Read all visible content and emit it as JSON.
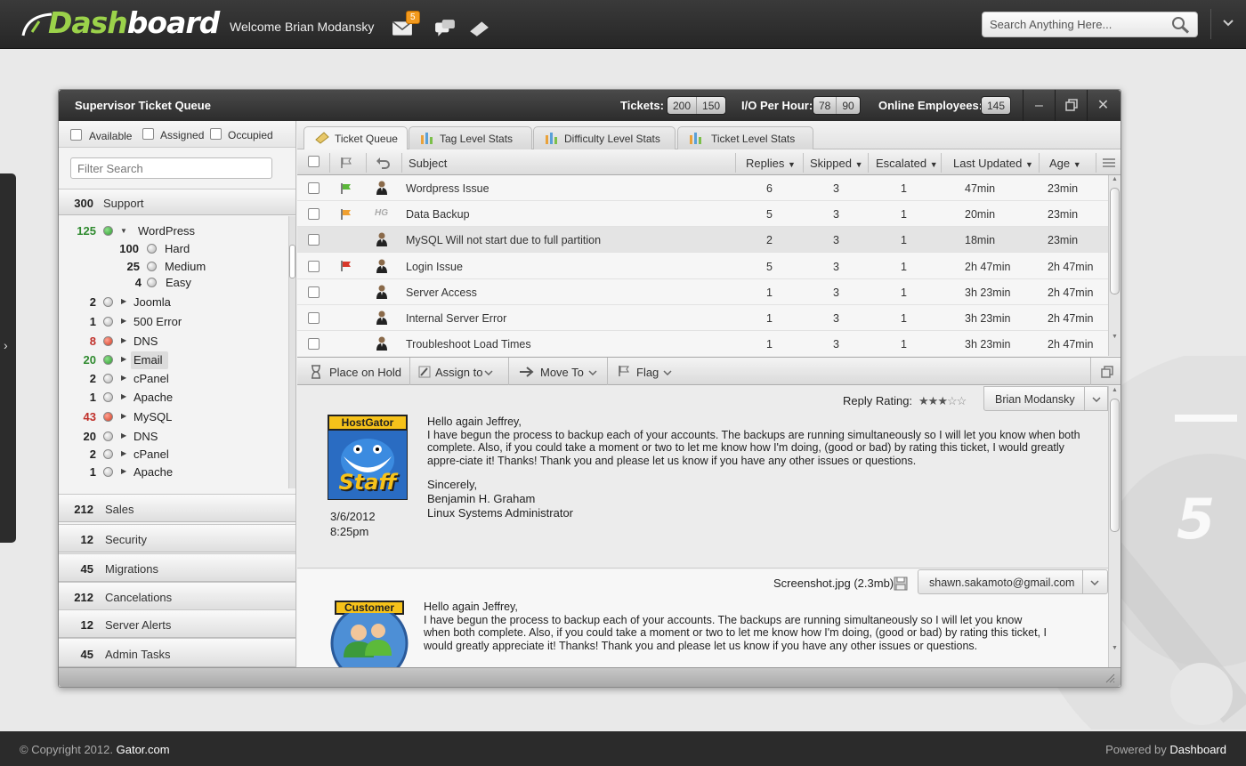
{
  "header": {
    "logo": {
      "part1": "Dash",
      "part2": "board"
    },
    "welcome": "Welcome Brian Modansky",
    "mail_badge": "5",
    "search_placeholder": "Search Anything Here..."
  },
  "window": {
    "title": "Supervisor Ticket Queue",
    "tickets_label": "Tickets:",
    "tickets_values": [
      "200",
      "150"
    ],
    "io_label": "I/O Per Hour:",
    "io_values": [
      "78",
      "90"
    ],
    "employees_label": "Online Employees:",
    "employees_value": "145"
  },
  "filters": {
    "available": "Available",
    "assigned": "Assigned",
    "occupied": "Occupied",
    "search_placeholder": "Filter Search"
  },
  "groups": [
    {
      "count": "300",
      "name": "Support"
    },
    {
      "count": "212",
      "name": "Sales"
    },
    {
      "count": "12",
      "name": "Security"
    },
    {
      "count": "45",
      "name": "Migrations"
    },
    {
      "count": "212",
      "name": "Cancelations"
    },
    {
      "count": "12",
      "name": "Server Alerts"
    },
    {
      "count": "45",
      "name": "Admin Tasks"
    }
  ],
  "tree": [
    {
      "count": "125",
      "label": "WordPress",
      "status": "green",
      "expanded": true
    },
    {
      "count": "100",
      "label": "Hard",
      "status": "none"
    },
    {
      "count": "25",
      "label": "Medium",
      "status": "none"
    },
    {
      "count": "4",
      "label": "Easy",
      "status": "none"
    },
    {
      "count": "2",
      "label": "Joomla",
      "status": "none"
    },
    {
      "count": "1",
      "label": "500 Error",
      "status": "none"
    },
    {
      "count": "8",
      "label": "DNS",
      "status": "red"
    },
    {
      "count": "20",
      "label": "Email",
      "status": "green"
    },
    {
      "count": "2",
      "label": "cPanel",
      "status": "none"
    },
    {
      "count": "1",
      "label": "Apache",
      "status": "none"
    },
    {
      "count": "43",
      "label": "MySQL",
      "status": "red"
    },
    {
      "count": "20",
      "label": "DNS",
      "status": "none"
    },
    {
      "count": "2",
      "label": "cPanel",
      "status": "none"
    },
    {
      "count": "1",
      "label": "Apache",
      "status": "none"
    }
  ],
  "tabs": [
    "Ticket Queue",
    "Tag Level Stats",
    "Difficulty Level Stats",
    "Ticket Level Stats"
  ],
  "columns": {
    "subject": "Subject",
    "replies": "Replies",
    "skipped": "Skipped",
    "escalated": "Escalated",
    "last_updated": "Last Updated",
    "age": "Age"
  },
  "tickets": [
    {
      "flag": "green",
      "owner": "person",
      "subject": "Wordpress Issue",
      "replies": "6",
      "skipped": "3",
      "escalated": "1",
      "updated": "47min",
      "age": "23min"
    },
    {
      "flag": "orange",
      "owner": "HG",
      "subject": "Data Backup",
      "replies": "5",
      "skipped": "3",
      "escalated": "1",
      "updated": "20min",
      "age": "23min"
    },
    {
      "flag": "none",
      "owner": "person",
      "subject": "MySQL Will not start due to full partition",
      "replies": "2",
      "skipped": "3",
      "escalated": "1",
      "updated": "18min",
      "age": "23min"
    },
    {
      "flag": "red",
      "owner": "person",
      "subject": "Login Issue",
      "replies": "5",
      "skipped": "3",
      "escalated": "1",
      "updated": "2h 47min",
      "age": "2h 47min"
    },
    {
      "flag": "none",
      "owner": "person",
      "subject": "Server Access",
      "replies": "1",
      "skipped": "3",
      "escalated": "1",
      "updated": "3h 23min",
      "age": "2h 47min"
    },
    {
      "flag": "none",
      "owner": "person",
      "subject": "Internal Server Error",
      "replies": "1",
      "skipped": "3",
      "escalated": "1",
      "updated": "3h 23min",
      "age": "2h 47min"
    },
    {
      "flag": "none",
      "owner": "person",
      "subject": "Troubleshoot Load Times",
      "replies": "1",
      "skipped": "3",
      "escalated": "1",
      "updated": "3h 23min",
      "age": "2h 47min"
    }
  ],
  "actions": {
    "hold": "Place on Hold",
    "assign": "Assign to",
    "move": "Move To",
    "flag": "Flag"
  },
  "message1": {
    "rating_label": "Reply Rating:",
    "rating": 3,
    "rating_max": 5,
    "author": "Brian Modansky",
    "avatar_top": "HostGator",
    "avatar_bottom": "Staff",
    "date": "3/6/2012",
    "time": "8:25pm",
    "greeting": "Hello again Jeffrey,",
    "body": "I have begun the process to backup each of your accounts. The backups are running simultaneously so I will let you know when both complete. Also, if you could take a moment or two to let me know how I'm doing, (good or bad) by rating this ticket, I would greatly appre-ciate it! Thanks! Thank you and please let us know if you have any other issues or questions.",
    "signoff": "Sincerely,",
    "sig_name": "Benjamin H. Graham",
    "sig_title": "Linux Systems Administrator"
  },
  "message2": {
    "attachment": "Screenshot.jpg (2.3mb)",
    "author": "shawn.sakamoto@gmail.com",
    "avatar_top": "Customer",
    "greeting": "Hello again Jeffrey,",
    "body": "I have begun the process to backup each of your accounts. The backups are running simultaneously so I will let you know when both complete. Also, if you could take a moment or two to let me know how I'm doing, (good or bad) by rating this ticket, I would greatly appreciate it! Thanks! Thank you and please let us know if you have any other issues or questions."
  },
  "footer": {
    "copyright_prefix": "© Copyright 2012.",
    "copyright_site": "Gator.com",
    "powered_prefix": "Powered by",
    "powered_name": "Dashboard"
  },
  "colors": {
    "accent_green": "#9bd24a",
    "badge_orange": "#f39a1e",
    "status_green": "#2f9a2f",
    "status_red": "#d1391f"
  }
}
